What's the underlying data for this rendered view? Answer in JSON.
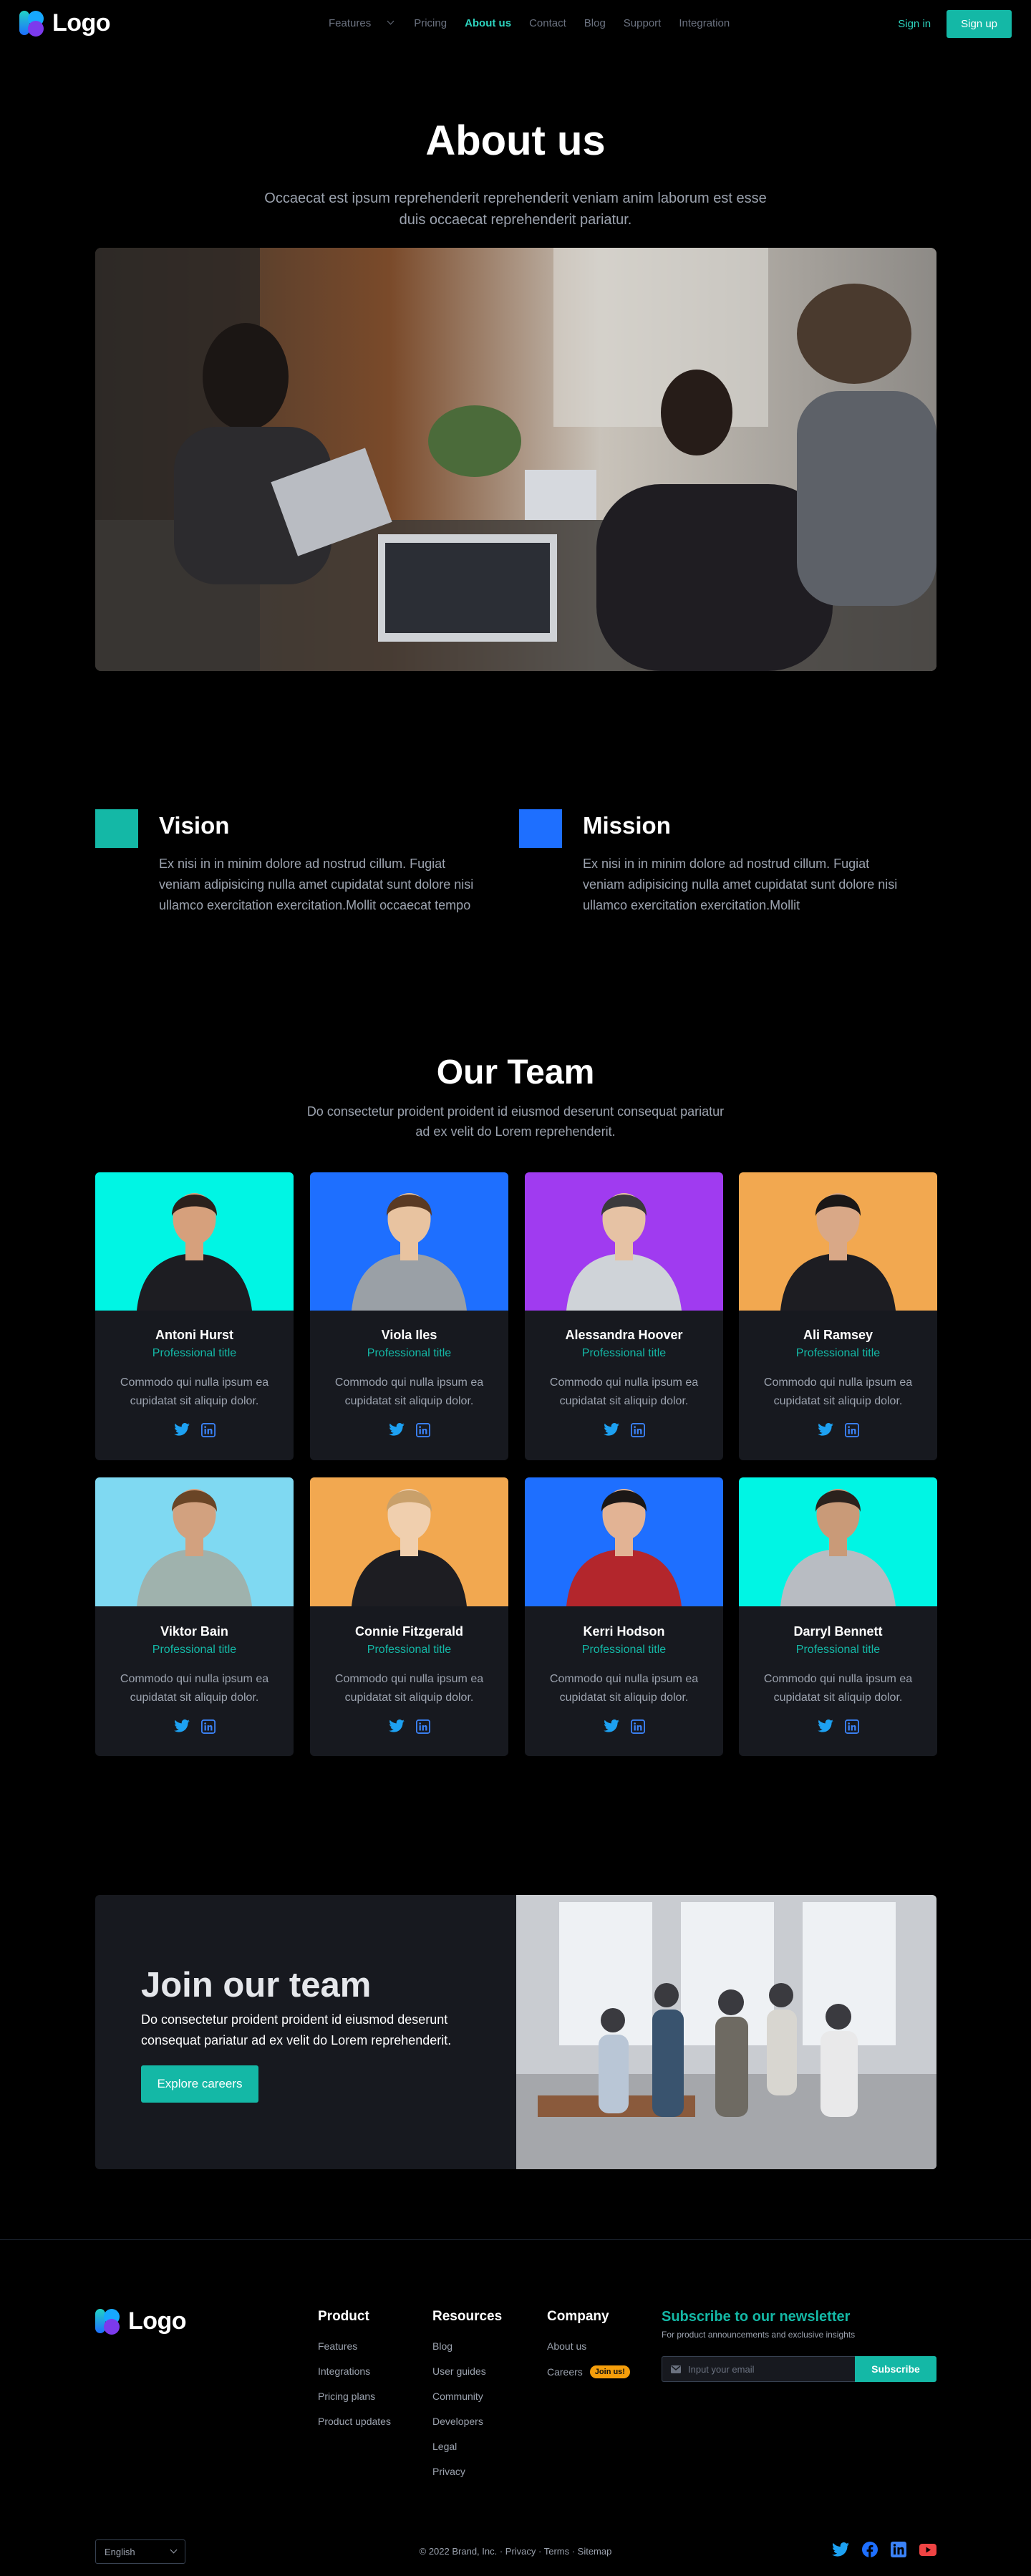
{
  "brand": {
    "logo_text": "Logo"
  },
  "nav": {
    "links": [
      "Features",
      "Pricing",
      "About us",
      "Contact",
      "Blog",
      "Support",
      "Integration"
    ],
    "active": "About us",
    "signin": "Sign in",
    "signup": "Sign up"
  },
  "hero": {
    "title": "About us",
    "subtitle": "Occaecat est ipsum reprehenderit reprehenderit veniam anim laborum est esse duis occaecat reprehenderit pariatur."
  },
  "vision": {
    "title": "Vision",
    "text": "Ex nisi in in minim dolore ad nostrud cillum. Fugiat veniam adipisicing nulla amet cupidatat sunt dolore nisi ullamco exercitation exercitation.Mollit occaecat tempo",
    "color": "#14b8a6"
  },
  "mission": {
    "title": "Mission",
    "text": "Ex nisi in in minim dolore ad nostrud cillum. Fugiat veniam adipisicing nulla amet cupidatat sunt dolore nisi ullamco exercitation exercitation.Mollit",
    "color": "#1e6fff"
  },
  "team": {
    "title": "Our Team",
    "subtitle": "Do consectetur proident proident id eiusmod deserunt consequat pariatur ad ex velit do Lorem reprehenderit.",
    "members": [
      {
        "name": "Antoni Hurst",
        "role": "Professional title",
        "desc": "Commodo qui nulla ipsum ea cupidatat sit aliquip dolor.",
        "bg": "#00f5e4"
      },
      {
        "name": "Viola Iles",
        "role": "Professional title",
        "desc": "Commodo qui nulla ipsum ea cupidatat sit aliquip dolor.",
        "bg": "#1e6fff"
      },
      {
        "name": "Alessandra Hoover",
        "role": "Professional title",
        "desc": "Commodo qui nulla ipsum ea cupidatat sit aliquip dolor.",
        "bg": "#a03bf0"
      },
      {
        "name": "Ali Ramsey",
        "role": "Professional title",
        "desc": "Commodo qui nulla ipsum ea cupidatat sit aliquip dolor.",
        "bg": "#f2a850"
      },
      {
        "name": "Viktor Bain",
        "role": "Professional title",
        "desc": "Commodo qui nulla ipsum ea cupidatat sit aliquip dolor.",
        "bg": "#7fd9f2"
      },
      {
        "name": "Connie Fitzgerald",
        "role": "Professional title",
        "desc": "Commodo qui nulla ipsum ea cupidatat sit aliquip dolor.",
        "bg": "#f2a850"
      },
      {
        "name": "Kerri Hodson",
        "role": "Professional title",
        "desc": "Commodo qui nulla ipsum ea cupidatat sit aliquip dolor.",
        "bg": "#1e6fff"
      },
      {
        "name": "Darryl Bennett",
        "role": "Professional title",
        "desc": "Commodo qui nulla ipsum ea cupidatat sit aliquip dolor.",
        "bg": "#00f5e4"
      }
    ]
  },
  "join": {
    "title": "Join our team",
    "text": "Do consectetur proident proident id eiusmod deserunt consequat pariatur ad ex velit do Lorem reprehenderit.",
    "button": "Explore careers"
  },
  "footer": {
    "product": {
      "title": "Product",
      "items": [
        "Features",
        "Integrations",
        "Pricing plans",
        "Product updates"
      ]
    },
    "resources": {
      "title": "Resources",
      "items": [
        "Blog",
        "User guides",
        "Community",
        "Developers",
        "Legal",
        "Privacy"
      ]
    },
    "company": {
      "title": "Company",
      "items": [
        "About us",
        "Careers"
      ],
      "badge": "Join us!"
    },
    "newsletter": {
      "title": "Subscribe to our newsletter",
      "subtitle": "For product announcements and exclusive insights",
      "placeholder": "Input your email",
      "button": "Subscribe"
    },
    "language": "English",
    "copyright": "© 2022 Brand, Inc. · Privacy · Terms · Sitemap"
  },
  "colors": {
    "accent": "#14b8a6",
    "twitter": "#1da1f2",
    "linkedin": "#3b82f6",
    "youtube": "#ef4444"
  }
}
